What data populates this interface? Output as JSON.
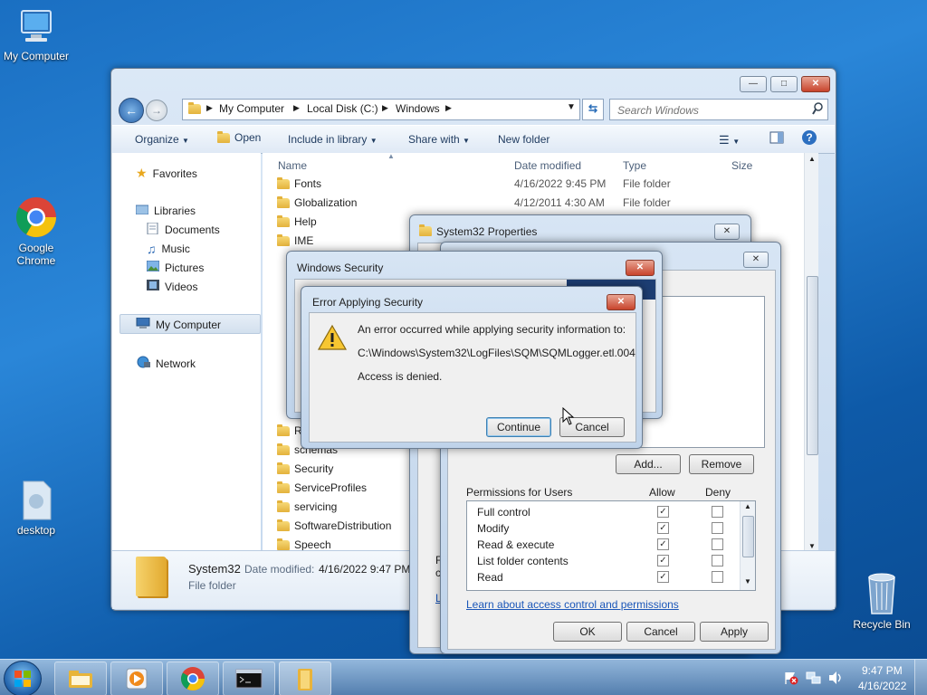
{
  "desktop": {
    "icons": {
      "my_computer": "My Computer",
      "google_chrome": "Google Chrome",
      "desktop": "desktop",
      "recycle_bin": "Recycle Bin"
    }
  },
  "explorer": {
    "breadcrumb": [
      "My Computer",
      "Local Disk (C:)",
      "Windows"
    ],
    "search_placeholder": "Search Windows",
    "toolbar": {
      "organize": "Organize",
      "open": "Open",
      "include_in_library": "Include in library",
      "share_with": "Share with",
      "new_folder": "New folder"
    },
    "nav": {
      "favorites": "Favorites",
      "libraries": "Libraries",
      "documents": "Documents",
      "music": "Music",
      "pictures": "Pictures",
      "videos": "Videos",
      "my_computer": "My Computer",
      "network": "Network"
    },
    "columns": {
      "name": "Name",
      "date_modified": "Date modified",
      "type": "Type",
      "size": "Size"
    },
    "rows": [
      {
        "name": "Fonts",
        "date": "4/16/2022 9:45 PM",
        "type": "File folder"
      },
      {
        "name": "Globalization",
        "date": "4/12/2011 4:30 AM",
        "type": "File folder"
      },
      {
        "name": "Help"
      },
      {
        "name": "IME"
      },
      {
        "name": "R"
      },
      {
        "name": "schemas"
      },
      {
        "name": "Security"
      },
      {
        "name": "ServiceProfiles"
      },
      {
        "name": "servicing"
      },
      {
        "name": "SoftwareDistribution"
      },
      {
        "name": "Speech"
      }
    ],
    "details": {
      "name": "System32",
      "date_label": "Date modified:",
      "date_value": "4/16/2022 9:47 PM",
      "type": "File folder"
    }
  },
  "props": {
    "title": "System32 Properties",
    "add": "Add...",
    "remove": "Remove",
    "permissions_for": "Permissions for Users",
    "allow": "Allow",
    "deny": "Deny",
    "permissions": [
      {
        "name": "Full control",
        "allow": true,
        "deny": false
      },
      {
        "name": "Modify",
        "allow": true,
        "deny": false
      },
      {
        "name": "Read & execute",
        "allow": true,
        "deny": false
      },
      {
        "name": "List folder contents",
        "allow": true,
        "deny": false
      },
      {
        "name": "Read",
        "allow": true,
        "deny": false
      }
    ],
    "learn_link": "Learn about access control and permissions",
    "ok": "OK",
    "cancel": "Cancel",
    "apply": "Apply",
    "partial_f": "F",
    "partial_c": "c",
    "partial_l": "L"
  },
  "winsec": {
    "title": "Windows Security"
  },
  "error": {
    "title": "Error Applying Security",
    "line1": "An error occurred while applying security information to:",
    "path": "C:\\Windows\\System32\\LogFiles\\SQM\\SQMLogger.etl.004",
    "line3": "Access is denied.",
    "continue": "Continue",
    "cancel": "Cancel"
  },
  "clock": {
    "time": "9:47 PM",
    "date": "4/16/2022"
  },
  "colors": {
    "accent": "#3c7fb1",
    "close": "#c8442c",
    "link": "#1a56b8"
  }
}
